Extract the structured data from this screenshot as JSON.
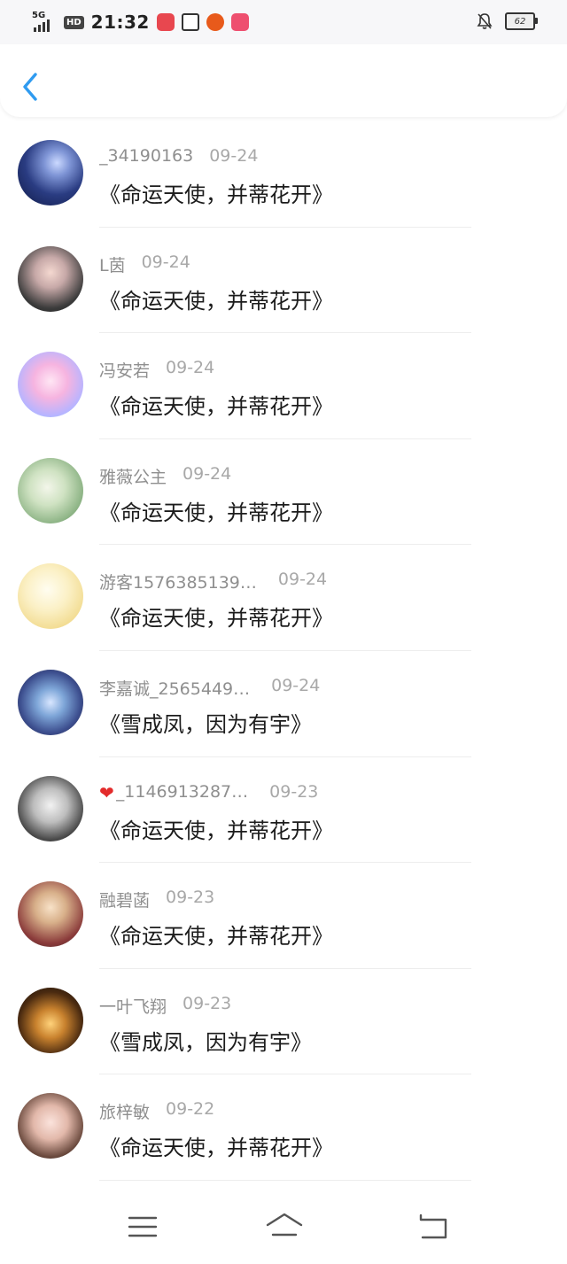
{
  "status_bar": {
    "network": "5G",
    "hd": "HD",
    "time": "21:32",
    "battery": "62",
    "icons": [
      "signal-icon",
      "hd-icon",
      "app-red-icon",
      "app-box-icon",
      "app-pumpkin-icon",
      "app-pink-icon",
      "bell-off-icon",
      "battery-icon"
    ]
  },
  "header": {
    "back_icon": "chevron-left-icon"
  },
  "items": [
    {
      "name": "_34190163",
      "date": "09-24",
      "message": "《命运天使，并蒂花开》"
    },
    {
      "name": "L茵",
      "date": "09-24",
      "message": "《命运天使，并蒂花开》"
    },
    {
      "name": "冯安若",
      "date": "09-24",
      "message": "《命运天使，并蒂花开》"
    },
    {
      "name": "雅薇公主",
      "date": "09-24",
      "message": "《命运天使，并蒂花开》"
    },
    {
      "name": "游客1576385139…",
      "date": "09-24",
      "message": "《命运天使，并蒂花开》"
    },
    {
      "name": "李嘉诚_2565449…",
      "date": "09-24",
      "message": "《雪成凤，因为有宇》"
    },
    {
      "name": "_1146913287…",
      "date": "09-23",
      "message": "《命运天使，并蒂花开》"
    },
    {
      "name": "融碧菡",
      "date": "09-23",
      "message": "《命运天使，并蒂花开》"
    },
    {
      "name": "一叶飞翔",
      "date": "09-23",
      "message": "《雪成凤，因为有宇》"
    },
    {
      "name": "旅梓敏",
      "date": "09-22",
      "message": "《命运天使，并蒂花开》"
    }
  ],
  "nav": {
    "icons": [
      "menu-icon",
      "home-icon",
      "back-icon"
    ]
  },
  "colors": {
    "accent": "#2f9bf0",
    "name": "#8f8f8f",
    "date": "#a8a8a8",
    "text": "#1c1c1c"
  }
}
